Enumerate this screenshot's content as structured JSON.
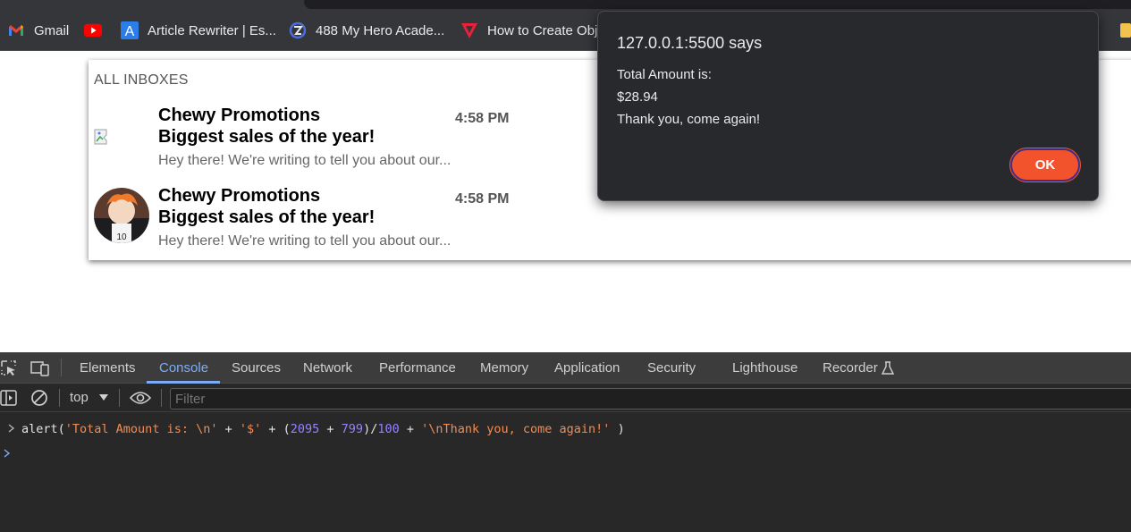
{
  "bookmarks": [
    {
      "label": "Gmail",
      "icon": "gmail-icon"
    },
    {
      "label": "",
      "icon": "youtube-icon"
    },
    {
      "label": "Article Rewriter | Es...",
      "icon": "article-rewriter-icon"
    },
    {
      "label": "488 My Hero Acade...",
      "icon": "manga-site-icon"
    },
    {
      "label": "How to Create Obj",
      "icon": "tutorial-site-icon"
    }
  ],
  "inbox": {
    "title": "ALL INBOXES",
    "emails": [
      {
        "from": "Chewy Promotions",
        "subject": "Biggest sales of the year!",
        "time": "4:58 PM",
        "preview": "Hey there! We're writing to tell you about our...",
        "avatar": "broken-image"
      },
      {
        "from": "Chewy Promotions",
        "subject": "Biggest sales of the year!",
        "time": "4:58 PM",
        "preview": "Hey there! We're writing to tell you about our...",
        "avatar": "profile-photo"
      }
    ]
  },
  "dialog": {
    "title": "127.0.0.1:5500 says",
    "lines": [
      "Total Amount is:",
      "$28.94",
      "Thank you, come again!"
    ],
    "ok_label": "OK",
    "ok_color": "#f2532d"
  },
  "devtools": {
    "tabs": [
      "Elements",
      "Console",
      "Sources",
      "Network",
      "Performance",
      "Memory",
      "Application",
      "Security",
      "Lighthouse",
      "Recorder"
    ],
    "active_tab": "Console",
    "context": "top",
    "filter_placeholder": "Filter",
    "console": {
      "fn": "alert(",
      "s1": "'Total Amount is: \\n'",
      "plus1": " + ",
      "s2": "'$'",
      "mid": " + (",
      "n1": "2095",
      "plus2": " + ",
      "n2": "799",
      "div": ")/",
      "n3": "100",
      "plus3": " + ",
      "s3": "'\\nThank you, come again!'",
      "close": " )"
    }
  }
}
